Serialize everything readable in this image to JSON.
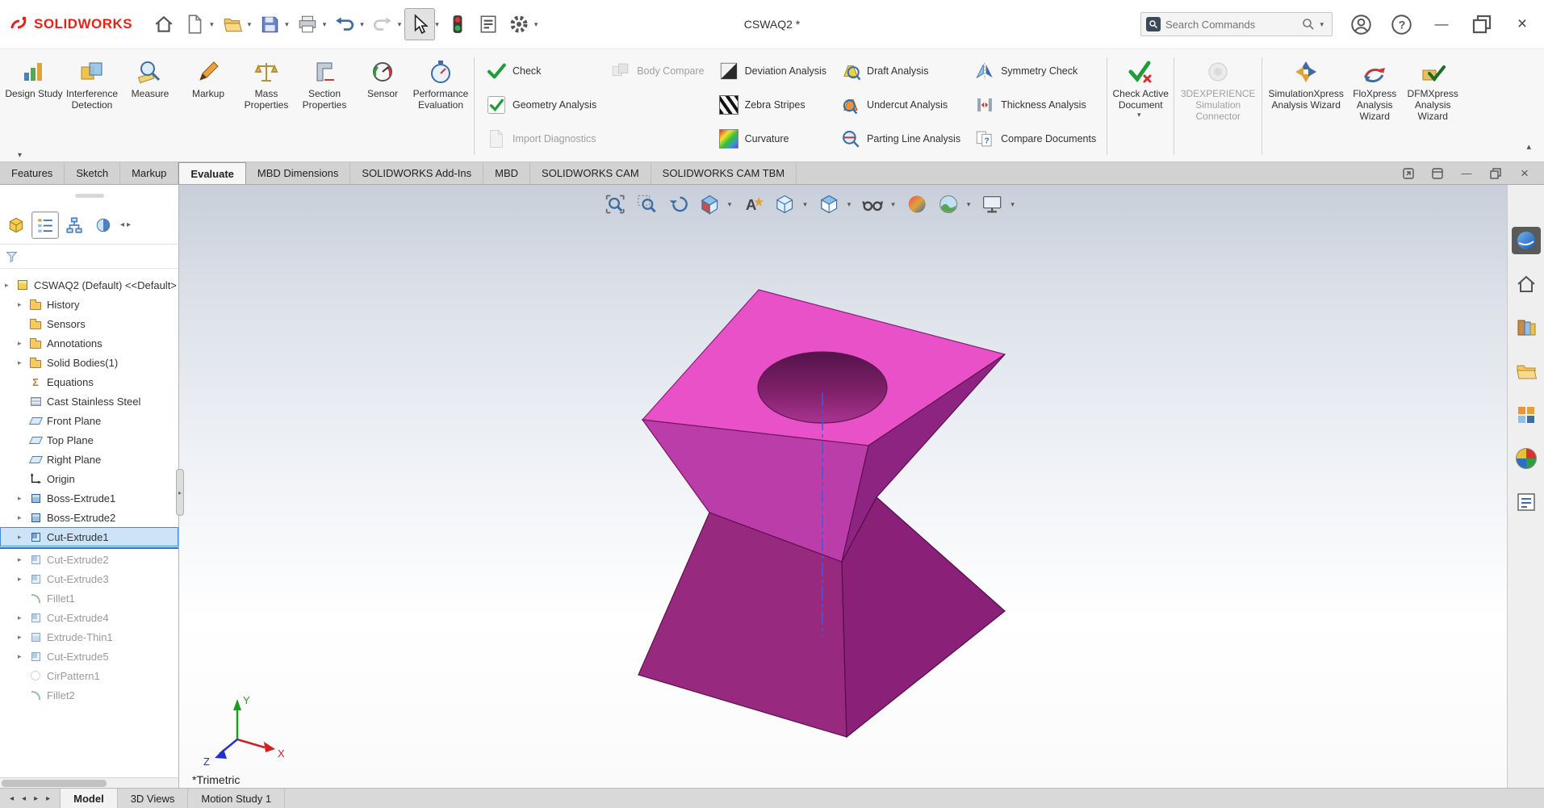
{
  "titlebar": {
    "logo": "SOLIDWORKS",
    "document_title": "CSWAQ2 *",
    "search_placeholder": "Search Commands"
  },
  "ribbon": {
    "buttons_left": [
      "Design Study",
      "Interference Detection",
      "Measure",
      "Markup",
      "Mass Properties",
      "Section Properties",
      "Sensor",
      "Performance Evaluation"
    ],
    "check_group": [
      "Check",
      "Geometry Analysis",
      "Import Diagnostics"
    ],
    "body_compare": "Body Compare",
    "analysis_group_1": [
      "Deviation Analysis",
      "Zebra Stripes",
      "Curvature"
    ],
    "analysis_group_2": [
      "Draft Analysis",
      "Undercut Analysis",
      "Parting Line Analysis"
    ],
    "analysis_group_3": [
      "Symmetry Check",
      "Thickness Analysis",
      "Compare Documents"
    ],
    "buttons_right": [
      "Check Active Document",
      "3DEXPERIENCE Simulation Connector",
      "SimulationXpress Analysis Wizard",
      "FloXpress Analysis Wizard",
      "DFMXpress Analysis Wizard"
    ]
  },
  "command_tabs": [
    "Features",
    "Sketch",
    "Markup",
    "Evaluate",
    "MBD Dimensions",
    "SOLIDWORKS Add-Ins",
    "MBD",
    "SOLIDWORKS CAM",
    "SOLIDWORKS CAM TBM"
  ],
  "active_command_tab": "Evaluate",
  "tree": {
    "root_label": "CSWAQ2 (Default) <<Default>",
    "items": [
      "History",
      "Sensors",
      "Annotations",
      "Solid Bodies(1)",
      "Equations",
      "Cast Stainless Steel",
      "Front Plane",
      "Top Plane",
      "Right Plane",
      "Origin",
      "Boss-Extrude1",
      "Boss-Extrude2",
      "Cut-Extrude1",
      "Cut-Extrude2",
      "Cut-Extrude3",
      "Fillet1",
      "Cut-Extrude4",
      "Extrude-Thin1",
      "Cut-Extrude5",
      "CirPattern1",
      "Fillet2"
    ],
    "selected_item": "Cut-Extrude1"
  },
  "viewport": {
    "view_orientation_label": "*Trimetric",
    "axis_labels": {
      "x": "X",
      "y": "Y",
      "z": "Z"
    }
  },
  "bottom_tabs": [
    "Model",
    "3D Views",
    "Motion Study 1"
  ],
  "glyphs": {
    "dropdown": "▾",
    "expander": "▸",
    "collapse": "▴",
    "close": "×",
    "minimize": "—",
    "help": "?",
    "question": "?",
    "letter_a": "A",
    "sigma": "Σ",
    "scroll_left": "◂",
    "scroll_right": "▸"
  },
  "colors": {
    "logo_red": "#e2231a",
    "selection_blue": "#2f6fd0",
    "model_top_face": "#e851c8",
    "model_upper_left_face": "#bb3da9",
    "model_upper_right_face": "#8e2481",
    "model_lower_left_face": "#97297f",
    "model_lower_right_face": "#8a2077"
  }
}
